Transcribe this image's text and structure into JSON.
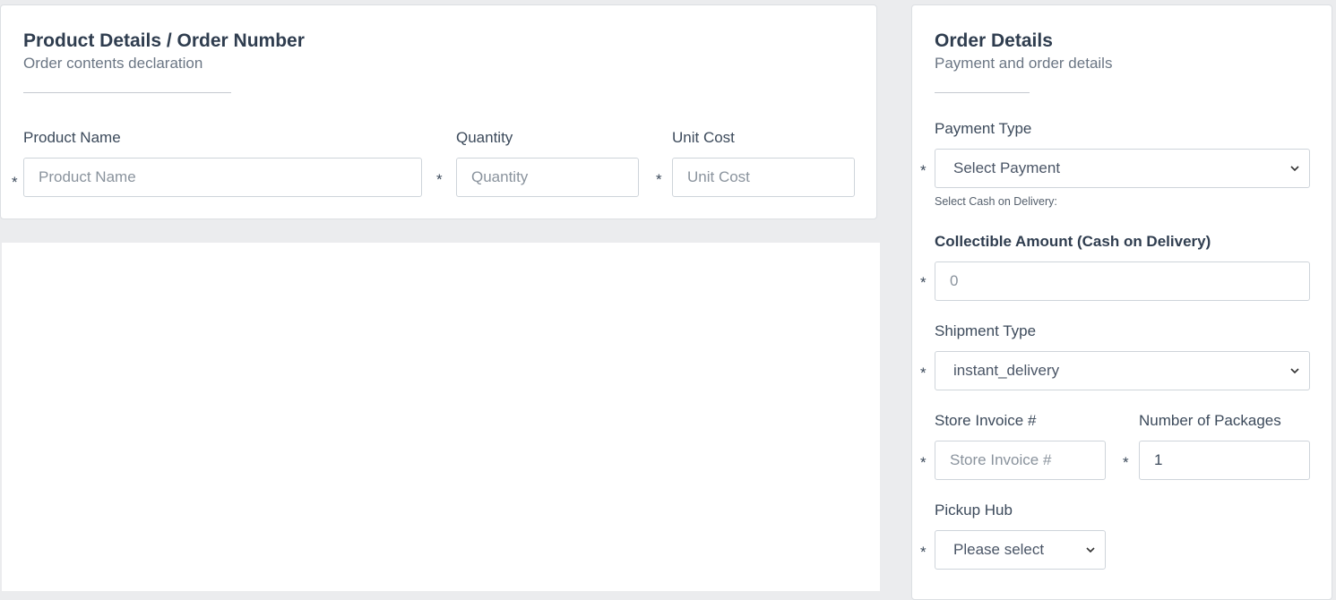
{
  "product_card": {
    "title": "Product Details / Order Number",
    "subtitle": "Order contents declaration",
    "fields": {
      "product_name": {
        "label": "Product Name",
        "placeholder": "Product Name",
        "required": "*"
      },
      "quantity": {
        "label": "Quantity",
        "placeholder": "Quantity",
        "required": "*"
      },
      "unit_cost": {
        "label": "Unit Cost",
        "placeholder": "Unit Cost",
        "required": "*"
      }
    }
  },
  "order_card": {
    "title": "Order Details",
    "subtitle": "Payment and order details",
    "payment_type": {
      "label": "Payment Type",
      "value": "Select Payment",
      "required": "*",
      "hint": "Select Cash on Delivery:"
    },
    "collectible_amount": {
      "label": "Collectible Amount (Cash on Delivery)",
      "placeholder": "0",
      "required": "*"
    },
    "shipment_type": {
      "label": "Shipment Type",
      "value": "instant_delivery",
      "required": "*"
    },
    "store_invoice": {
      "label": "Store Invoice #",
      "placeholder": "Store Invoice #",
      "required": "*"
    },
    "number_of_packages": {
      "label": "Number of Packages",
      "value": "1",
      "required": "*"
    },
    "pickup_hub": {
      "label": "Pickup Hub",
      "value": "Please select",
      "required": "*"
    }
  },
  "colors": {
    "background": "#ebecee",
    "card": "#ffffff",
    "text": "#3c4a5b",
    "border": "#ced4da"
  },
  "icons": {
    "select_arrow": "chevron-down-icon"
  }
}
